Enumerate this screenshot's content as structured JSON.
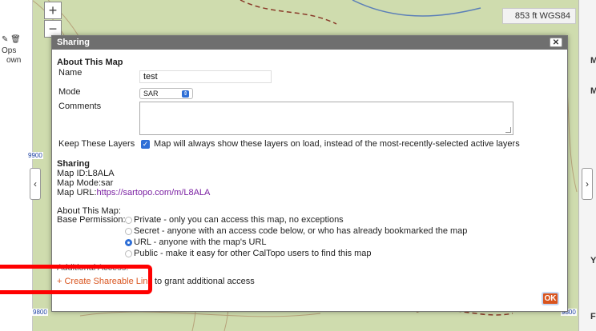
{
  "map": {
    "coordinate_readout": "853 ft  WGS84",
    "left_panel": {
      "ops_label": "Ops",
      "own_label": "own",
      "edge_label_top": "9900",
      "edge_label_bottom": "9800"
    },
    "right_panel": {
      "letters": [
        "M",
        "M",
        "Y",
        "F"
      ],
      "edge_label_bottom": "9800"
    }
  },
  "dialog": {
    "title": "Sharing",
    "close_label": "✕",
    "about_heading": "About This Map",
    "name_label": "Name",
    "name_value": "test",
    "mode_label": "Mode",
    "mode_value": "SAR",
    "comments_label": "Comments",
    "comments_value": "",
    "keep_layers_label": "Keep These Layers",
    "keep_layers_text": "Map will always show these layers on load, instead of the most-recently-selected active layers",
    "keep_layers_checked": true,
    "sharing_heading": "Sharing",
    "map_id": "Map ID:L8ALA",
    "map_mode": "Map Mode:sar",
    "map_url_label": "Map URL:",
    "map_url": "https://sartopo.com/m/L8ALA",
    "about_this_map": "About This Map:",
    "base_permission_label": "Base Permission:",
    "permissions": [
      {
        "label": "Private - only you can access this map, no exceptions",
        "selected": false
      },
      {
        "label": "Secret - anyone with an access code below, or who has already bookmarked the map",
        "selected": false
      },
      {
        "label": "URL - anyone with the map's URL",
        "selected": true
      },
      {
        "label": "Public - make it easy for other CalTopo users to find this map",
        "selected": false
      }
    ],
    "additional_access": "Additional Access:",
    "create_link": "+ Create Shareable Link",
    "create_link_suffix": " to grant additional access",
    "ok_label": "OK"
  },
  "colors": {
    "accent": "#2f6fd6",
    "action_orange": "#d9541e",
    "titlebar": "#6f6f6f",
    "annotation_red": "#ff0000"
  }
}
